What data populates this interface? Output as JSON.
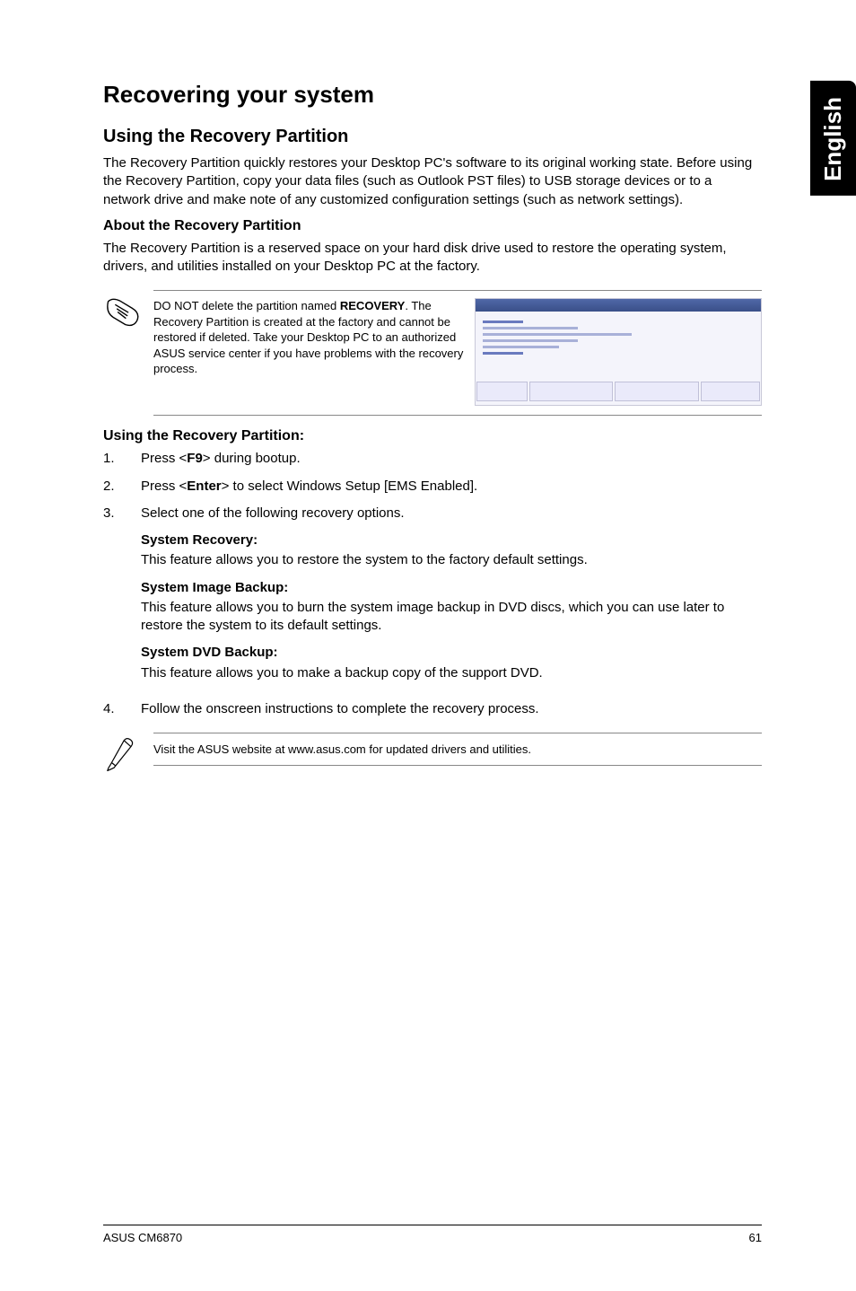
{
  "sideTab": "English",
  "title": "Recovering your system",
  "section1": {
    "heading": "Using the Recovery Partition",
    "intro": "The Recovery Partition quickly restores your Desktop PC's software to its original working state. Before using the Recovery Partition, copy your data files (such as Outlook PST files) to USB storage devices or to a network drive and make note of any customized configuration settings (such as network settings).",
    "aboutHeading": "About the Recovery Partition",
    "aboutBody": "The Recovery Partition is a reserved space on your hard disk drive used to restore the operating system, drivers, and utilities installed on your Desktop PC at the factory."
  },
  "cautionNote": {
    "pre": "DO NOT delete the partition named ",
    "bold": "RECOVERY",
    "post": ". The Recovery Partition is created at the factory and cannot be restored if deleted. Take your Desktop PC to an authorized ASUS service center if you have problems with the recovery process."
  },
  "steps": {
    "heading": "Using the Recovery Partition:",
    "items": [
      {
        "num": "1.",
        "pre": "Press <",
        "key": "F9",
        "post": "> during bootup."
      },
      {
        "num": "2.",
        "pre": "Press <",
        "key": "Enter",
        "post": "> to select Windows Setup [EMS Enabled]."
      },
      {
        "num": "3.",
        "text": "Select one of the following recovery options.",
        "subs": [
          {
            "title": "System Recovery:",
            "body": "This feature allows you to restore the system to the factory default settings."
          },
          {
            "title": "System Image Backup:",
            "body": "This feature allows you to burn the system image backup in DVD discs, which you can use later to restore the system to its default settings."
          },
          {
            "title": "System DVD Backup:",
            "body": "This feature allows you to make a backup copy of the support DVD."
          }
        ]
      },
      {
        "num": "4.",
        "text": "Follow the onscreen instructions to complete the recovery process."
      }
    ]
  },
  "tip": "Visit the ASUS website at www.asus.com for updated drivers and utilities.",
  "footer": {
    "left": "ASUS CM6870",
    "right": "61"
  }
}
